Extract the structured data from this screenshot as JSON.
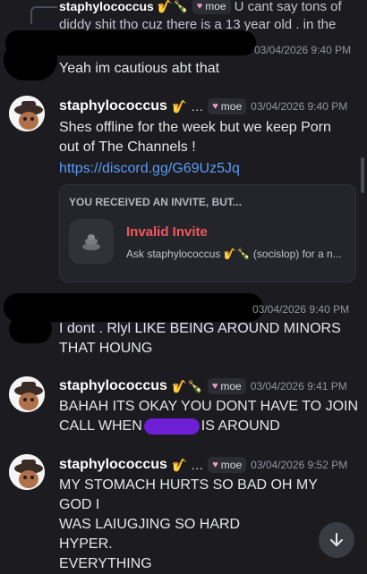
{
  "reply_preview": {
    "username": "staphylococcus",
    "emojis": "🎷🍾",
    "tag": "moe",
    "line1_rest": "U cant say tons of",
    "line2": "diddy shit tho cuz there is a 13 year old . in the server"
  },
  "messages": [
    {
      "timestamp": "03/04/2026 9:40 PM",
      "text_lines": [
        "Yeah im cautious abt that"
      ]
    },
    {
      "username": "staphylococcus",
      "emojis": "🎷 …",
      "tag": "moe",
      "timestamp": "03/04/2026 9:40 PM",
      "text_lines": [
        "Shes offline for the week but we keep Porn",
        "out of The Channels !"
      ],
      "link": "https://discord.gg/G69Uz5Jq",
      "invite": {
        "header": "YOU RECEIVED AN INVITE, BUT...",
        "title": "Invalid Invite",
        "subtitle": "Ask staphylococcus 🎷🍾 (socislop) for a n..."
      }
    },
    {
      "timestamp": "03/04/2026 9:40 PM",
      "text_lines": [
        "I dont . Rlyl LIKE BEING AROUND MINORS",
        "THAT HOUNG"
      ]
    },
    {
      "username": "staphylococcus",
      "emojis": "🎷🍾",
      "tag": "moe",
      "timestamp": "03/04/2026 9:41 PM",
      "text_lines": [
        "BAHAH ITS OKAY YOU DONT HAVE TO JOIN"
      ],
      "line2_start": "CALL WHEN",
      "line2_end": "IS AROUND"
    },
    {
      "username": "staphylococcus",
      "emojis": "🎷 …",
      "tag": "moe",
      "timestamp": "03/04/2026 9:52 PM",
      "text_lines": [
        "MY STOMACH HURTS SO BAD OH MY GOD I",
        "WAS LAIUGJING SO HARD",
        "HYPER.",
        "EVERYTHING"
      ]
    }
  ],
  "colors": {
    "background": "#1b1b20",
    "link": "#5b9cf5",
    "invalid": "#f2585d",
    "redaction_purple": "#6e1fd6"
  }
}
